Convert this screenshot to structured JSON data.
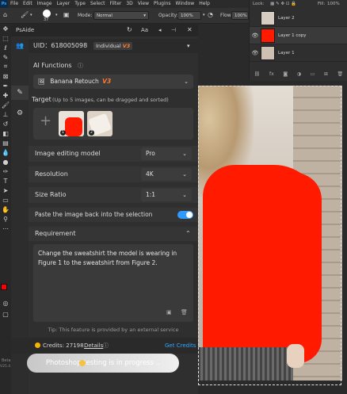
{
  "menubar": {
    "app_badge": "Ps",
    "items": [
      "File",
      "Edit",
      "Image",
      "Layer",
      "Type",
      "Select",
      "Filter",
      "3D",
      "View",
      "Plugins",
      "Window",
      "Help"
    ]
  },
  "options_bar": {
    "brush_size": "37",
    "mode_label": "Mode:",
    "mode_value": "Normal",
    "opacity_label": "Opacity:",
    "opacity_value": "100%",
    "flow_label": "Flow:",
    "flow_value": "100%"
  },
  "layers_panel": {
    "lock_label": "Lock:",
    "fill_label": "Fill:",
    "fill_value": "100%",
    "layers": [
      {
        "name": "Layer 2"
      },
      {
        "name": "Layer 1 copy"
      },
      {
        "name": "Layer 1"
      }
    ]
  },
  "tools_bottom": {
    "beta": "Beta",
    "version": "V25.4.1"
  },
  "plugin": {
    "title": "PsAide",
    "uid_text": "UID：618005098",
    "plan_label": "Individual",
    "plan_tier": "V3",
    "ai_functions_label": "AI Functions",
    "function_selected": "Banana Retouch",
    "function_version": "V3",
    "target_label": "Target",
    "target_hint": "(Up to 5 images, can be dragged and sorted)",
    "thumb1_index": "1",
    "thumb2_index": "2",
    "model_label": "Image editing model",
    "model_value": "Pro",
    "resolution_label": "Resolution",
    "resolution_value": "4K",
    "size_ratio_label": "Size Ratio",
    "size_ratio_value": "1:1",
    "paste_back_label": "Paste the image back into the selection",
    "paste_back_on": true,
    "requirement_label": "Requirement",
    "requirement_text": "Change the sweatshirt the model is wearing in Figure 1 to the sweatshirt from Figure 2.",
    "tip": "Tip: This feature is provided by an external service",
    "credits_label": "Credits: 27198",
    "details_link": "Details",
    "get_credits": "Get Credits",
    "progress_text": "Photoshop testing is in progress ..",
    "header_font_btn": "Aa"
  },
  "colors": {
    "accent_blue": "#31a8ff",
    "toggle_blue": "#2f9bff",
    "red_fill": "#ff1a00",
    "credit_coin": "#f5b400",
    "version_orange": "#ff7a2f"
  }
}
